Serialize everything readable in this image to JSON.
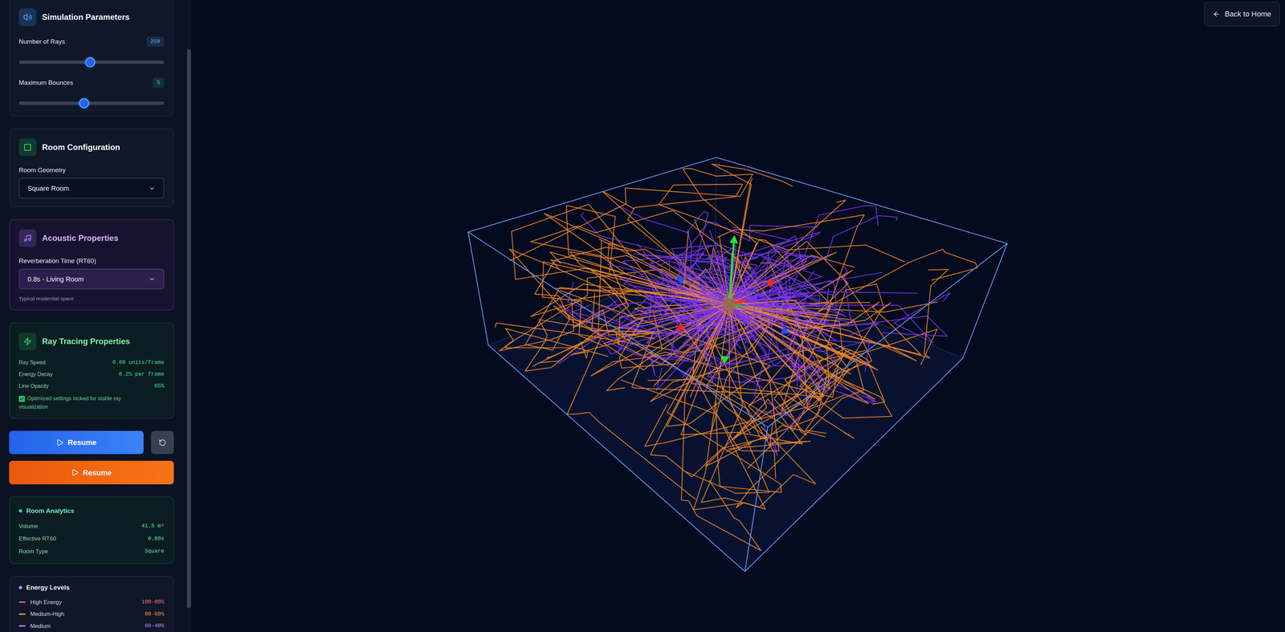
{
  "sidebar": {
    "simulation_parameters": {
      "title": "Simulation Parameters",
      "sliders": [
        {
          "label": "Number of Rays",
          "value": "250",
          "level": 0.49,
          "color": "#60a5fa"
        },
        {
          "label": "Maximum Bounces",
          "value": "5",
          "level": 0.45,
          "color": "#34d399"
        }
      ]
    },
    "room_configuration": {
      "title": "Room Configuration",
      "field_label": "Room Geometry",
      "selected_option": "Square Room"
    },
    "acoustic_properties": {
      "title": "Acoustic Properties",
      "field_label": "Reverberation Time (RT60)",
      "selected_option": "0.8s - Living Room",
      "hint": "Typical residential space"
    },
    "ray_tracing_properties": {
      "title": "Ray Tracing Properties",
      "rows": [
        {
          "label": "Ray Speed",
          "value": "0.08 units/frame"
        },
        {
          "label": "Energy Decay",
          "value": "0.2% per frame"
        },
        {
          "label": "Line Opacity",
          "value": "85%"
        }
      ],
      "lock": {
        "label": "Optimized settings locked for stable ray visualization",
        "checked": true
      }
    },
    "controls": {
      "play_button": "Resume",
      "record_button": "Resume"
    },
    "room_analytics": {
      "title": "Room Analytics",
      "rows": [
        {
          "label": "Volume",
          "value": "41.5 m³"
        },
        {
          "label": "Effective RT60",
          "value": "0.80s"
        },
        {
          "label": "Room Type",
          "value": "Square"
        }
      ]
    },
    "energy_levels": {
      "title": "Energy Levels",
      "rows": [
        {
          "label": "High Energy",
          "value": "100-80%",
          "color": "#f87171"
        },
        {
          "label": "Medium-High",
          "value": "80-60%",
          "color": "#fb923c"
        },
        {
          "label": "Medium",
          "value": "60-40%",
          "color": "#c084fc"
        }
      ]
    }
  },
  "back_button": "Back to Home"
}
